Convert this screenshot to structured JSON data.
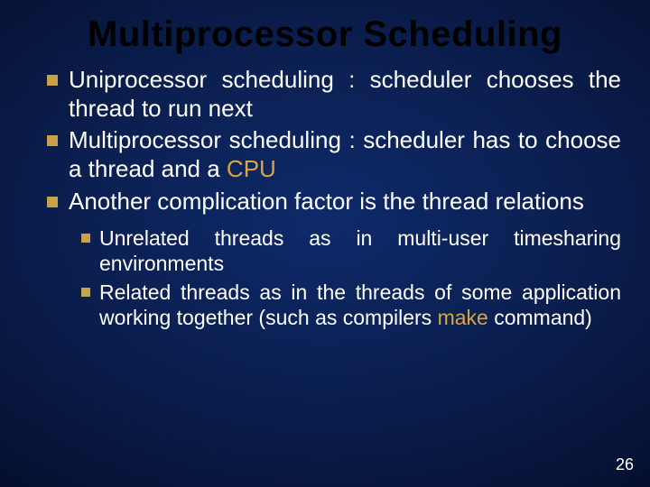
{
  "title": "Multiprocessor Scheduling",
  "bullets": [
    {
      "pre": "Uniprocessor scheduling : scheduler chooses the thread to run next",
      "accent": "",
      "post": ""
    },
    {
      "pre": "Multiprocessor scheduling : scheduler has to choose a thread and a ",
      "accent": "CPU",
      "post": ""
    },
    {
      "pre": "Another complication factor is the thread relations",
      "accent": "",
      "post": ""
    }
  ],
  "subbullets": [
    {
      "pre": "Unrelated threads as in multi-user timesharing environments",
      "accent": "",
      "post": ""
    },
    {
      "pre": "Related threads as in the threads of some application working together (such as compilers ",
      "accent": "make",
      "post": " command)"
    }
  ],
  "page_number": "26"
}
